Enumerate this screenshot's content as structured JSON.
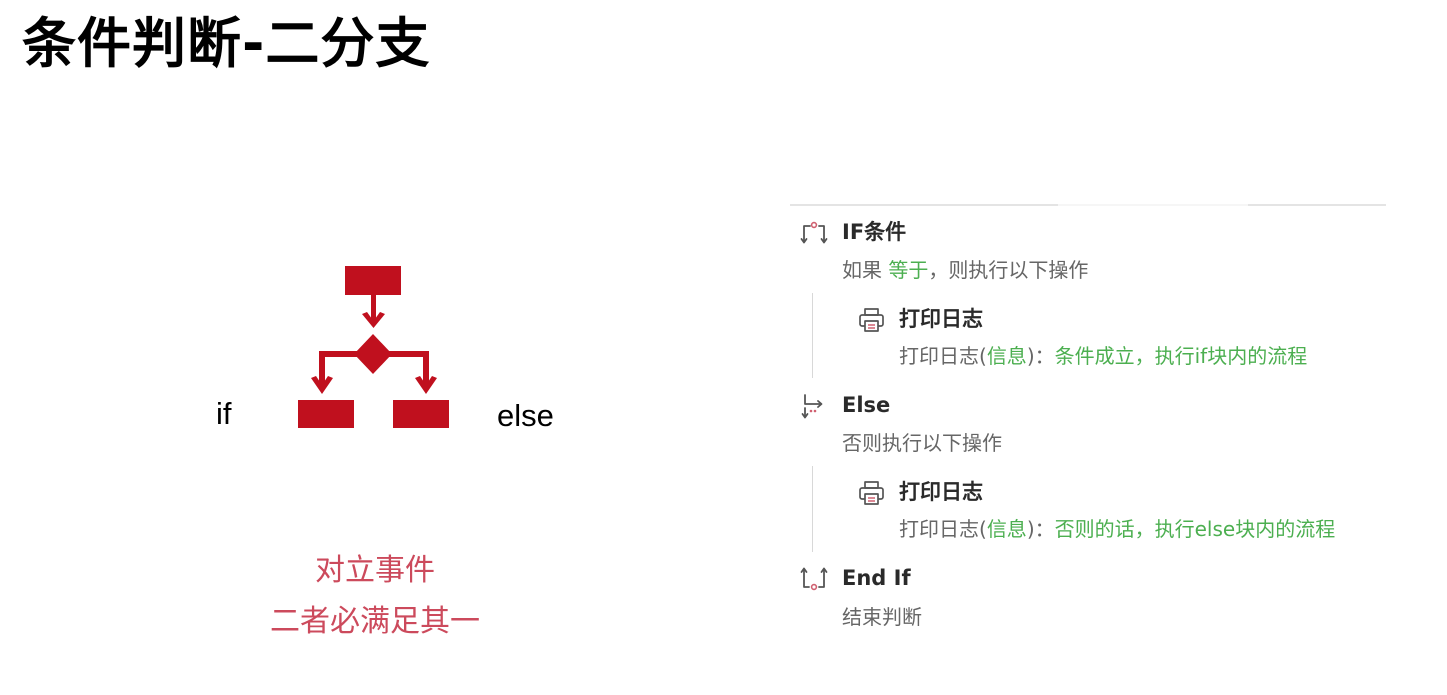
{
  "title": "条件判断-二分支",
  "diagram": {
    "if_label": "if",
    "else_label": "else",
    "caption_line1": "对立事件",
    "caption_line2": "二者必满足其一",
    "accent_color": "#c0101e"
  },
  "flow": {
    "if_block": {
      "icon": "if-branch-icon",
      "title": "IF条件",
      "desc_prefix": "如果 ",
      "desc_highlight": "等于",
      "desc_suffix": "，则执行以下操作"
    },
    "if_log": {
      "icon": "printer-icon",
      "title": "打印日志",
      "desc_prefix": "打印日志(",
      "desc_param": "信息",
      "desc_mid": ")：",
      "desc_value": "条件成立，执行if块内的流程"
    },
    "else_block": {
      "icon": "else-branch-icon",
      "title": "Else",
      "desc": "否则执行以下操作"
    },
    "else_log": {
      "icon": "printer-icon",
      "title": "打印日志",
      "desc_prefix": "打印日志(",
      "desc_param": "信息",
      "desc_mid": ")：",
      "desc_value": "否则的话，执行else块内的流程"
    },
    "end_block": {
      "icon": "end-if-icon",
      "title": "End If",
      "desc": "结束判断"
    }
  },
  "colors": {
    "highlight_green": "#4caf50",
    "caption_red": "#cc4a5c",
    "icon_accent": "#d06070"
  }
}
